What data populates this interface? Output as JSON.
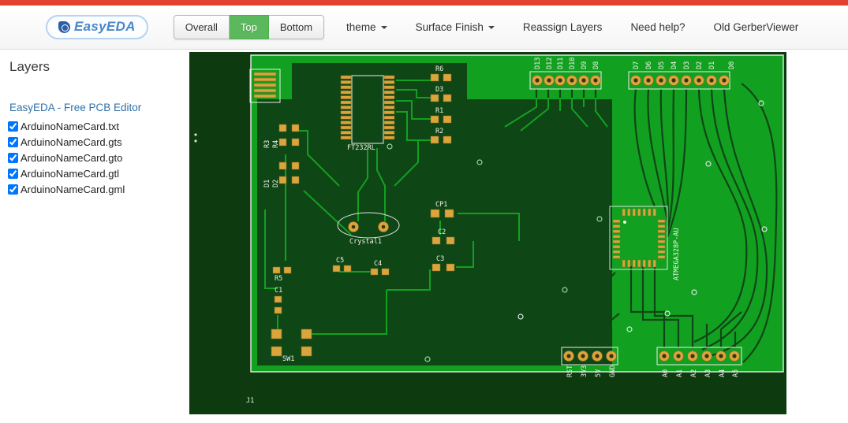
{
  "colors": {
    "top_strip": "#e2432e",
    "active_button_green": "#5cb85c",
    "link_blue": "#3071a9",
    "board_green": "#12a021",
    "copper_pour_dark": "#0f4616",
    "pad_gold": "#d9a53c",
    "silkscreen_white": "#eef2e6",
    "canvas_dark_green": "#0e3a10"
  },
  "header": {
    "logo_text": "EasyEDA",
    "view_buttons": {
      "overall": "Overall",
      "top": "Top",
      "bottom": "Bottom",
      "active": "Top"
    },
    "menu": {
      "theme": "theme",
      "surface_finish": "Surface Finish",
      "reassign_layers": "Reassign Layers",
      "need_help": "Need help?",
      "old_viewer": "Old GerberViewer"
    }
  },
  "sidebar": {
    "title": "Layers",
    "editor_link": "EasyEDA - Free PCB Editor",
    "files": [
      "ArduinoNameCard.txt",
      "ArduinoNameCard.gts",
      "ArduinoNameCard.gto",
      "ArduinoNameCard.gtl",
      "ArduinoNameCard.gml"
    ],
    "files_checked": [
      true,
      true,
      true,
      true,
      true
    ]
  },
  "pcb": {
    "silkscreen": {
      "ft232rl": "FT232RL",
      "r6": "R6",
      "d3_top": "D3",
      "r1": "R1",
      "r2": "R2",
      "r3": "R3",
      "r4": "R4",
      "d1": "D1",
      "d2": "D2",
      "cp1": "CP1",
      "c2": "C2",
      "crystal1": "Crystal1",
      "c5": "C5",
      "c4": "C4",
      "c3": "C3",
      "r5": "R5",
      "c1": "C1",
      "sw1": "SW1",
      "j1": "J1",
      "mcu": "ATMEGA328P-AU"
    },
    "digital_pins_left": [
      "D13",
      "D12",
      "D11",
      "D10",
      "D9",
      "D8"
    ],
    "digital_pins_right": [
      "D7",
      "D6",
      "D5",
      "D4",
      "D3",
      "D2",
      "D1",
      "D0"
    ],
    "power_pins": [
      "RST",
      "3V3",
      "5V",
      "GND"
    ],
    "analog_pins": [
      "A0",
      "A1",
      "A2",
      "A3",
      "A4",
      "A5"
    ]
  }
}
